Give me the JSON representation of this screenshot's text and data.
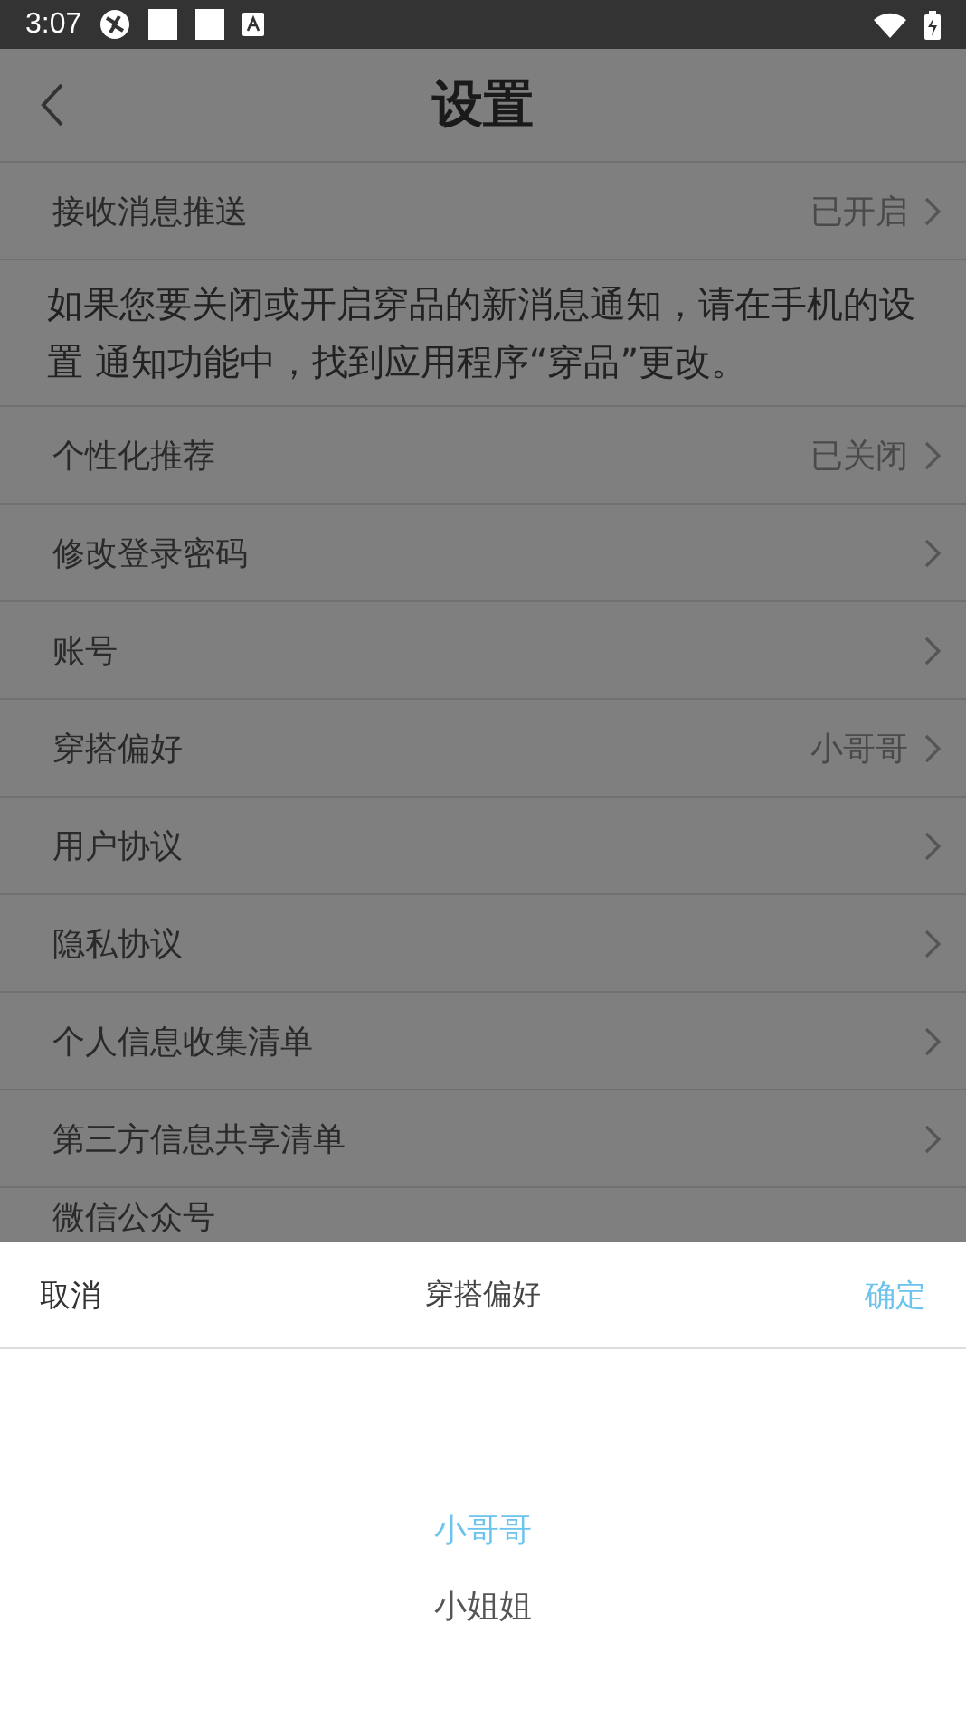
{
  "status_bar": {
    "time": "3:07"
  },
  "header": {
    "title": "设置"
  },
  "rows": [
    {
      "kind": "row",
      "label": "接收消息推送",
      "value": "已开启"
    },
    {
      "kind": "note",
      "label": "如果您要关闭或开启穿品的新消息通知，请在手机的设置 通知功能中，找到应用程序“穿品”更改。"
    },
    {
      "kind": "row",
      "label": "个性化推荐",
      "value": "已关闭"
    },
    {
      "kind": "row",
      "label": "修改登录密码"
    },
    {
      "kind": "row",
      "label": "账号"
    },
    {
      "kind": "row",
      "label": "穿搭偏好",
      "value": "小哥哥"
    },
    {
      "kind": "row",
      "label": "用户协议"
    },
    {
      "kind": "row",
      "label": "隐私协议"
    },
    {
      "kind": "row",
      "label": "个人信息收集清单"
    },
    {
      "kind": "row",
      "label": "第三方信息共享清单"
    },
    {
      "kind": "row",
      "label": "微信公众号"
    }
  ],
  "sheet": {
    "cancel": "取消",
    "title": "穿搭偏好",
    "confirm": "确定",
    "options": [
      {
        "label": "小哥哥",
        "selected": true
      },
      {
        "label": "小姐姐",
        "selected": false
      }
    ]
  }
}
